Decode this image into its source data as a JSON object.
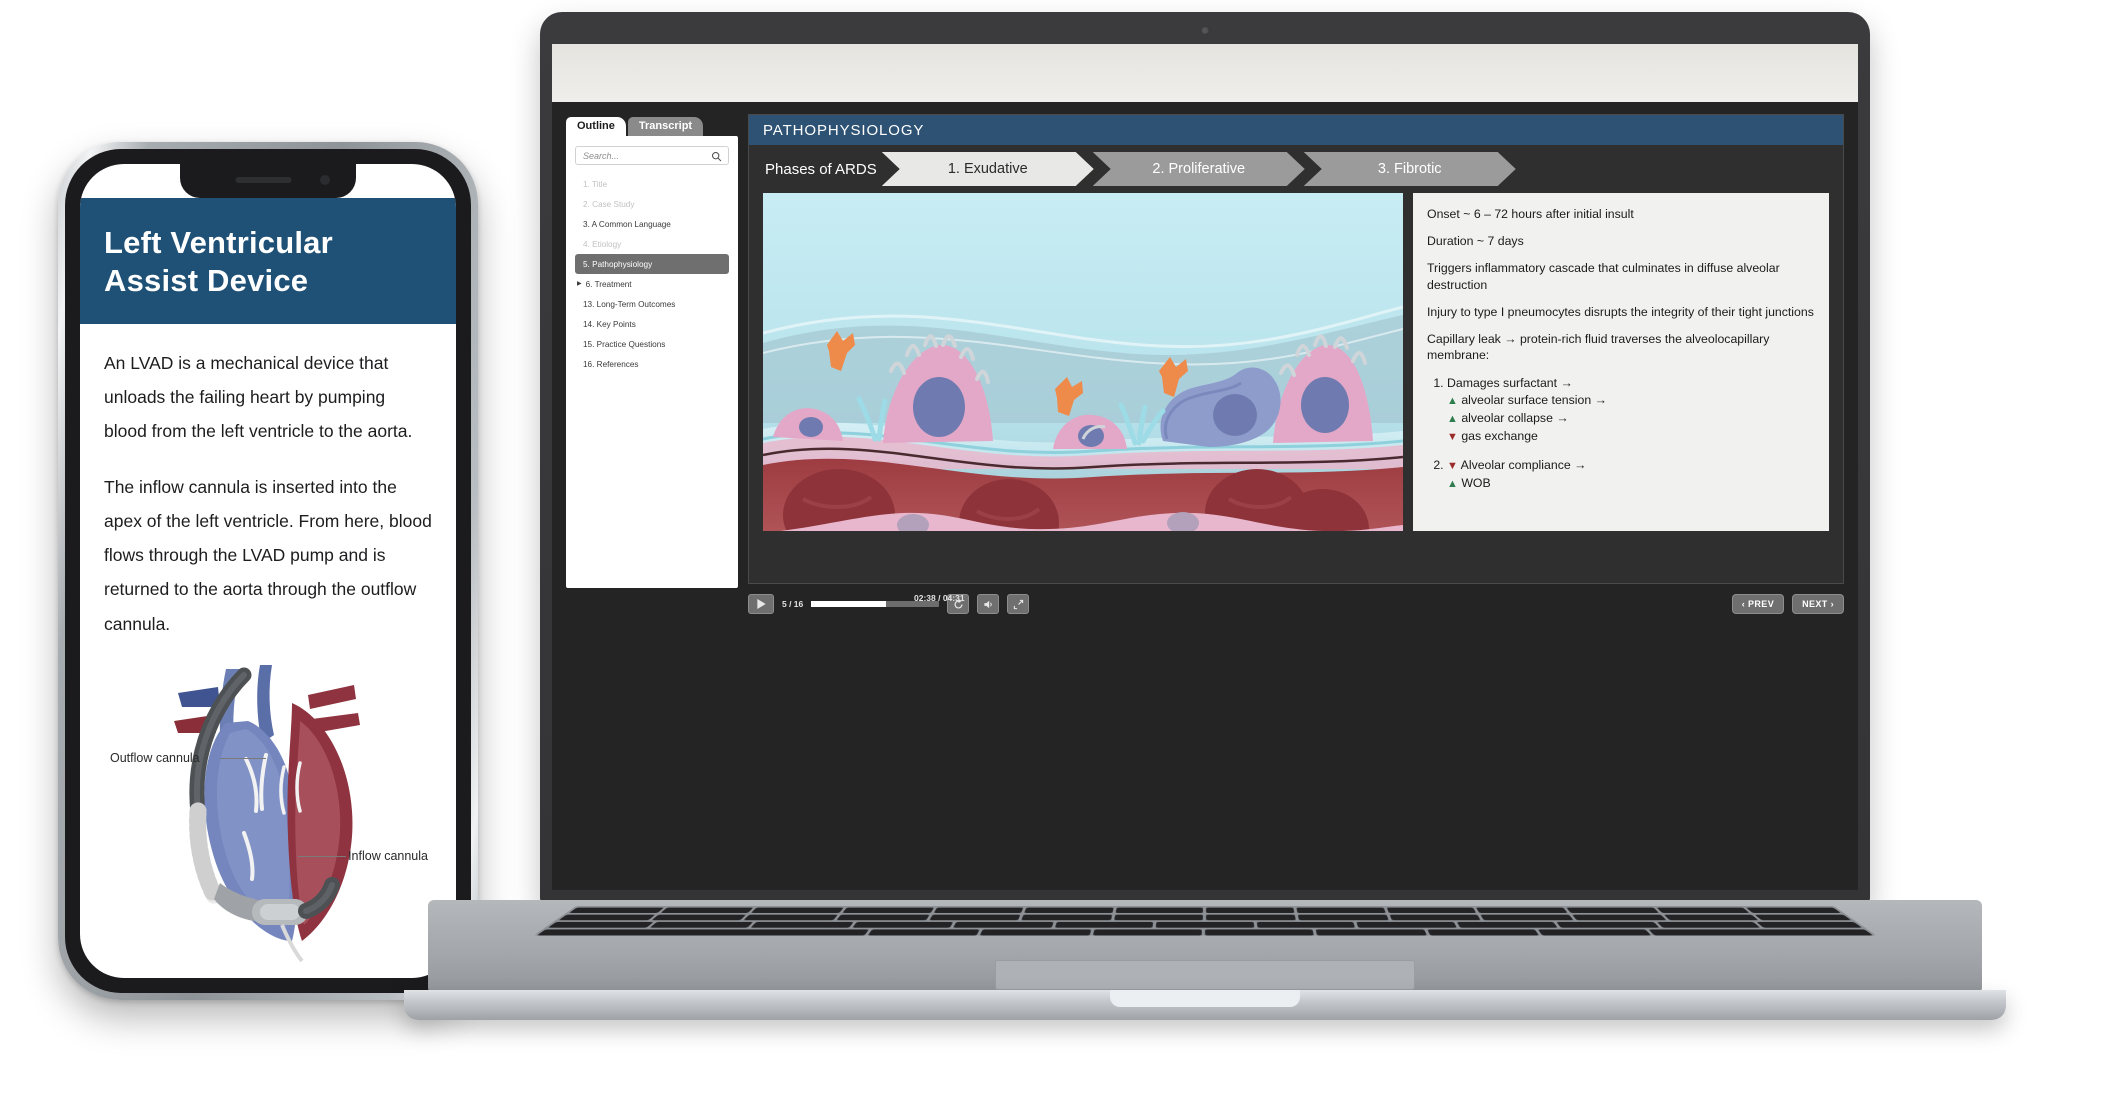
{
  "phone": {
    "header_title": "Left Ventricular Assist Device",
    "header_color": "#1f5076",
    "paragraphs": [
      "An LVAD is a mechanical device that unloads the failing heart by pumping blood from the left ventricle to the aorta.",
      "The inflow cannula is inserted into the apex of the left ventricle. From here, blood flows through the LVAD pump and is returned to the aorta through the outflow cannula."
    ],
    "diagram_labels": {
      "outflow": "Outflow cannula",
      "inflow": "Inflow cannula"
    }
  },
  "laptop": {
    "tabs": [
      {
        "label": "Outline",
        "active": true
      },
      {
        "label": "Transcript",
        "active": false
      }
    ],
    "search": {
      "placeholder": "Search...",
      "icon": "search-icon"
    },
    "outline_items": [
      {
        "label": "1. Title",
        "state": "dim"
      },
      {
        "label": "2. Case Study",
        "state": "dim"
      },
      {
        "label": "3. A Common Language",
        "state": "normal"
      },
      {
        "label": "4. Etiology",
        "state": "dim"
      },
      {
        "label": "5. Pathophysiology",
        "state": "active"
      },
      {
        "label": "6. Treatment",
        "state": "normal",
        "expandable": true
      },
      {
        "label": "13. Long-Term Outcomes",
        "state": "normal"
      },
      {
        "label": "14. Key Points",
        "state": "normal"
      },
      {
        "label": "15. Practice Questions",
        "state": "normal"
      },
      {
        "label": "16. References",
        "state": "normal"
      }
    ],
    "slide": {
      "title": "PATHOPHYSIOLOGY",
      "title_color": "#2d5274",
      "chevron_label": "Phases of ARDS",
      "phases": [
        {
          "label": "1. Exudative",
          "active": true
        },
        {
          "label": "2. Proliferative",
          "active": false
        },
        {
          "label": "3. Fibrotic",
          "active": false
        }
      ],
      "text_panel": {
        "paragraphs": [
          "Onset ~ 6 – 72 hours after initial insult",
          "Duration ~ 7 days",
          "Triggers inflammatory cascade that culminates in diffuse alveolar destruction",
          "Injury to type I pneumocytes disrupts the integrity of their tight junctions",
          "Capillary leak → protein-rich fluid traverses the alveolocapillary membrane:"
        ],
        "list": [
          {
            "lines": [
              {
                "arrow": "none",
                "text": "Damages surfactant →"
              },
              {
                "arrow": "up",
                "text": "alveolar surface tension →"
              },
              {
                "arrow": "up",
                "text": "alveolar collapse →"
              },
              {
                "arrow": "down",
                "text": "gas exchange"
              }
            ]
          },
          {
            "lines": [
              {
                "arrow": "down",
                "text": "Alveolar compliance →"
              },
              {
                "arrow": "up",
                "text": "WOB"
              }
            ]
          }
        ],
        "arrow_up_color": "#2e7d4f",
        "arrow_down_color": "#9b2b28"
      }
    },
    "controls": {
      "play_icon": "play-icon",
      "slide_counter": "5 / 16",
      "time": "02:38 / 04:31",
      "progress_percent": 58,
      "replay_icon": "replay-icon",
      "volume_icon": "volume-icon",
      "fullscreen_icon": "fullscreen-icon",
      "prev_label": "‹ PREV",
      "next_label": "NEXT ›"
    }
  }
}
